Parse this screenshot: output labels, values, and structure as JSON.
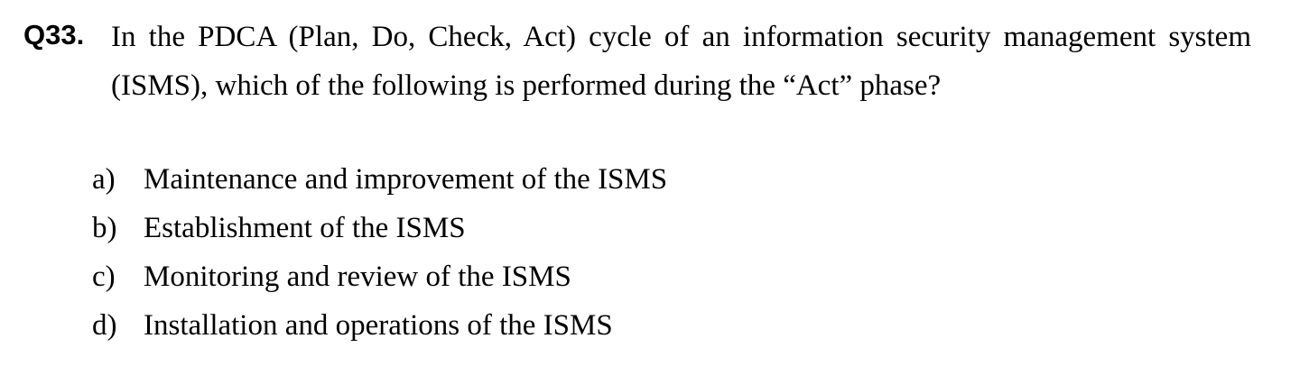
{
  "question": {
    "number": "Q33.",
    "text": "In the PDCA (Plan, Do, Check, Act) cycle of an information security management system (ISMS), which of the following is performed during the “Act” phase?"
  },
  "options": [
    {
      "label": "a)",
      "text": "Maintenance and improvement of the ISMS"
    },
    {
      "label": "b)",
      "text": "Establishment of the ISMS"
    },
    {
      "label": "c)",
      "text": "Monitoring and review of the ISMS"
    },
    {
      "label": "d)",
      "text": "Installation and operations of the ISMS"
    }
  ]
}
